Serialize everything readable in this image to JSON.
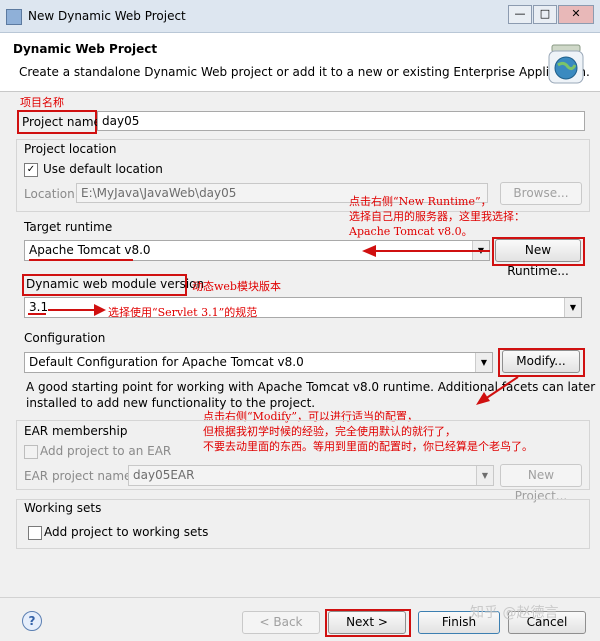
{
  "window": {
    "title": "New Dynamic Web Project",
    "minimize": "—",
    "maximize": "□",
    "close": "✕"
  },
  "header": {
    "title": "Dynamic Web Project",
    "description": "Create a standalone Dynamic Web project or add it to a new or existing Enterprise Application."
  },
  "project": {
    "annotation": "项目名称",
    "name_label": "Project name:",
    "name_value": "day05"
  },
  "location": {
    "group_label": "Project location",
    "use_default_label": "Use default location",
    "use_default_checked": true,
    "location_label": "Location:",
    "location_value": "E:\\MyJava\\JavaWeb\\day05",
    "browse_label": "Browse...",
    "annotation_lines": [
      "点击右侧“New Runtime”，",
      "选择自己用的服务器，这里我选择：",
      "Apache Tomcat v8.0。"
    ]
  },
  "runtime": {
    "label": "Target runtime",
    "selected": "Apache Tomcat v8.0",
    "new_runtime_label": "New Runtime..."
  },
  "module": {
    "label": "Dynamic web module version",
    "annotation": "动态web模块版本",
    "selected": "3.1",
    "annotation2": "选择使用“Servlet 3.1”的规范"
  },
  "configuration": {
    "label": "Configuration",
    "selected": "Default Configuration for Apache Tomcat v8.0",
    "modify_label": "Modify...",
    "description_line1": "A good starting point for working with Apache Tomcat v8.0 runtime. Additional facets can later be",
    "description_line2": "installed to add new functionality to the project.",
    "annotation_lines": [
      "点击右侧“Modify”，可以进行适当的配置，",
      "但根据我初学时候的经验，完全使用默认的就行了，",
      "不要去动里面的东西。等用到里面的配置时，你已经算是个老鸟了。"
    ]
  },
  "ear": {
    "group_label": "EAR membership",
    "add_label": "Add project to an EAR",
    "project_name_label": "EAR project name:",
    "project_name_value": "day05EAR",
    "new_project_label": "New Project..."
  },
  "working_sets": {
    "group_label": "Working sets",
    "add_label": "Add project to working sets"
  },
  "footer": {
    "help": "?",
    "back_label": "< Back",
    "next_label": "Next >",
    "finish_label": "Finish",
    "cancel_label": "Cancel",
    "watermark": "知乎 @赵德言"
  },
  "colors": {
    "annotation_red": "#e00000",
    "background": "#f0f0f0"
  }
}
